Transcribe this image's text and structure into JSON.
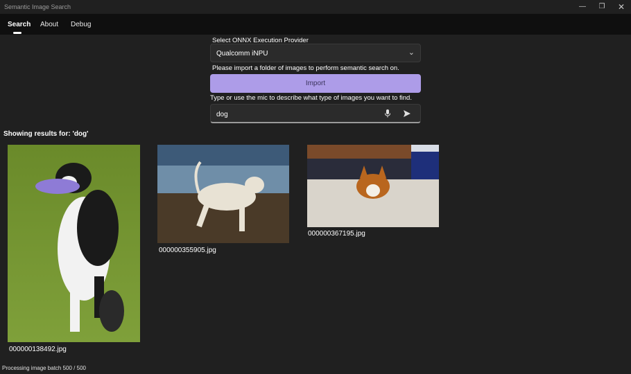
{
  "window": {
    "title": "Semantic Image Search",
    "controls": [
      "minimize",
      "restore",
      "close"
    ]
  },
  "nav": {
    "tabs": [
      {
        "label": "Search",
        "active": true
      },
      {
        "label": "About",
        "active": false
      },
      {
        "label": "Debug",
        "active": false
      }
    ]
  },
  "provider": {
    "label": "Select ONNX Execution Provider",
    "selected": "Qualcomm iNPU"
  },
  "import": {
    "hint": "Please import a folder of images to perform semantic search on.",
    "button_label": "Import"
  },
  "search": {
    "hint": "Type or use the mic to describe what type of images you want to find.",
    "value": "dog"
  },
  "results": {
    "heading": "Showing results for: 'dog'",
    "items": [
      {
        "filename": "000000138492.jpg"
      },
      {
        "filename": "000000355905.jpg"
      },
      {
        "filename": "000000367195.jpg"
      }
    ]
  },
  "status": "Processing image batch 500 / 500",
  "colors": {
    "background": "#202020",
    "navbar": "#0f0f0f",
    "accent": "#ad9ce8"
  }
}
